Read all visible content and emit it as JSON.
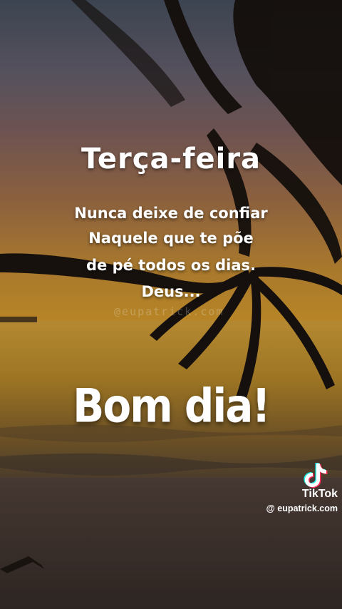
{
  "card": {
    "day": "Terça-feira",
    "message_lines": [
      "Nunca deixe de confiar",
      "Naquele que te põe",
      "de pé todos os dias.",
      "Deus..."
    ],
    "watermark": "@eupatrick.com",
    "greeting": "Bom dia!"
  },
  "tiktok": {
    "icon": "tiktok-logo-icon",
    "brand": "TikTok",
    "handle": "@ eupatrick.com"
  },
  "colors": {
    "text": "#ffffff",
    "sky_top": "#4e5868",
    "sunset": "#f0b030",
    "sand": "#3a302c"
  }
}
